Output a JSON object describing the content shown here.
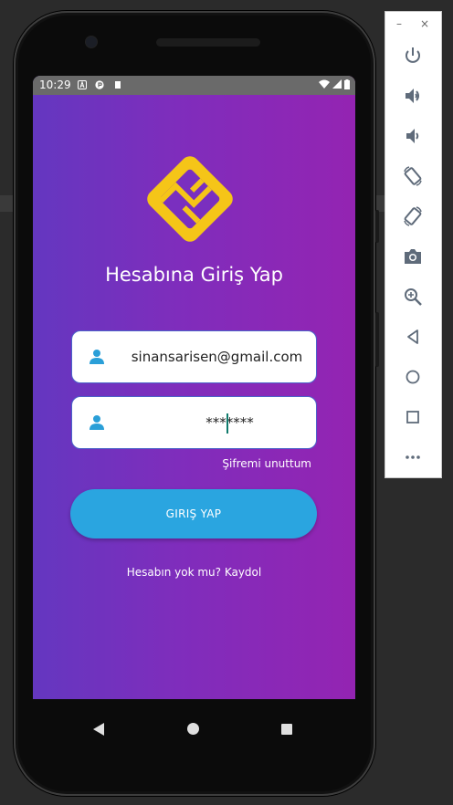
{
  "status_bar": {
    "time": "10:29"
  },
  "app": {
    "title": "Hesabına Giriş Yap",
    "email_value": "sinansarisen@gmail.com",
    "password_value": "*******",
    "forgot_label": "Şifremi unuttum",
    "login_label": "GIRIŞ YAP",
    "signup_label": "Hesabın yok mu? Kaydol",
    "colors": {
      "gradient_start": "#6437c0",
      "gradient_end": "#9424b2",
      "button": "#2aa5e0",
      "logo": "#f5c518"
    }
  },
  "emulator_toolbar": {
    "minimize": "–",
    "close": "×",
    "icons": [
      "power-icon",
      "volume-up-icon",
      "volume-down-icon",
      "rotate-left-icon",
      "rotate-right-icon",
      "camera-icon",
      "zoom-icon",
      "back-icon",
      "home-icon",
      "overview-icon",
      "more-icon"
    ]
  }
}
